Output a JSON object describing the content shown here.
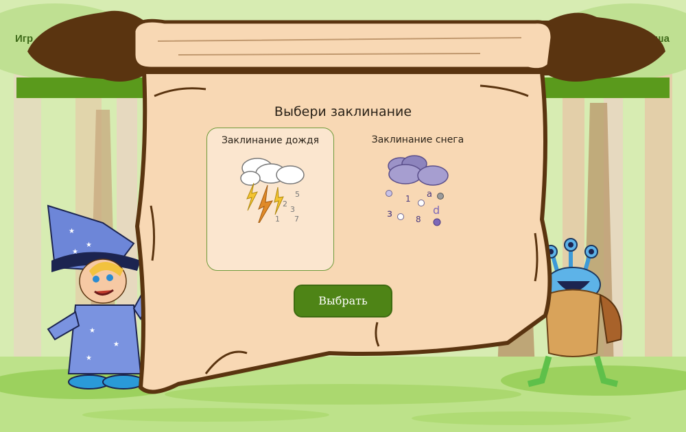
{
  "header": {
    "left_text": "Игр",
    "right_text": "ша"
  },
  "dialog": {
    "title": "Выбери заклинание",
    "options": [
      {
        "label": "Заклинание дождя",
        "icon": "rain-spell-icon",
        "selected": true
      },
      {
        "label": "Заклинание снега",
        "icon": "snow-spell-icon",
        "selected": false
      }
    ],
    "button_label": "Выбрать"
  },
  "characters": {
    "left": "wizard-boy",
    "right": "blue-monster"
  },
  "colors": {
    "accent": "#4e8416",
    "scroll": "#f8d8b4",
    "scroll_border": "#5a3410",
    "header_bar": "#5a9a1c"
  }
}
